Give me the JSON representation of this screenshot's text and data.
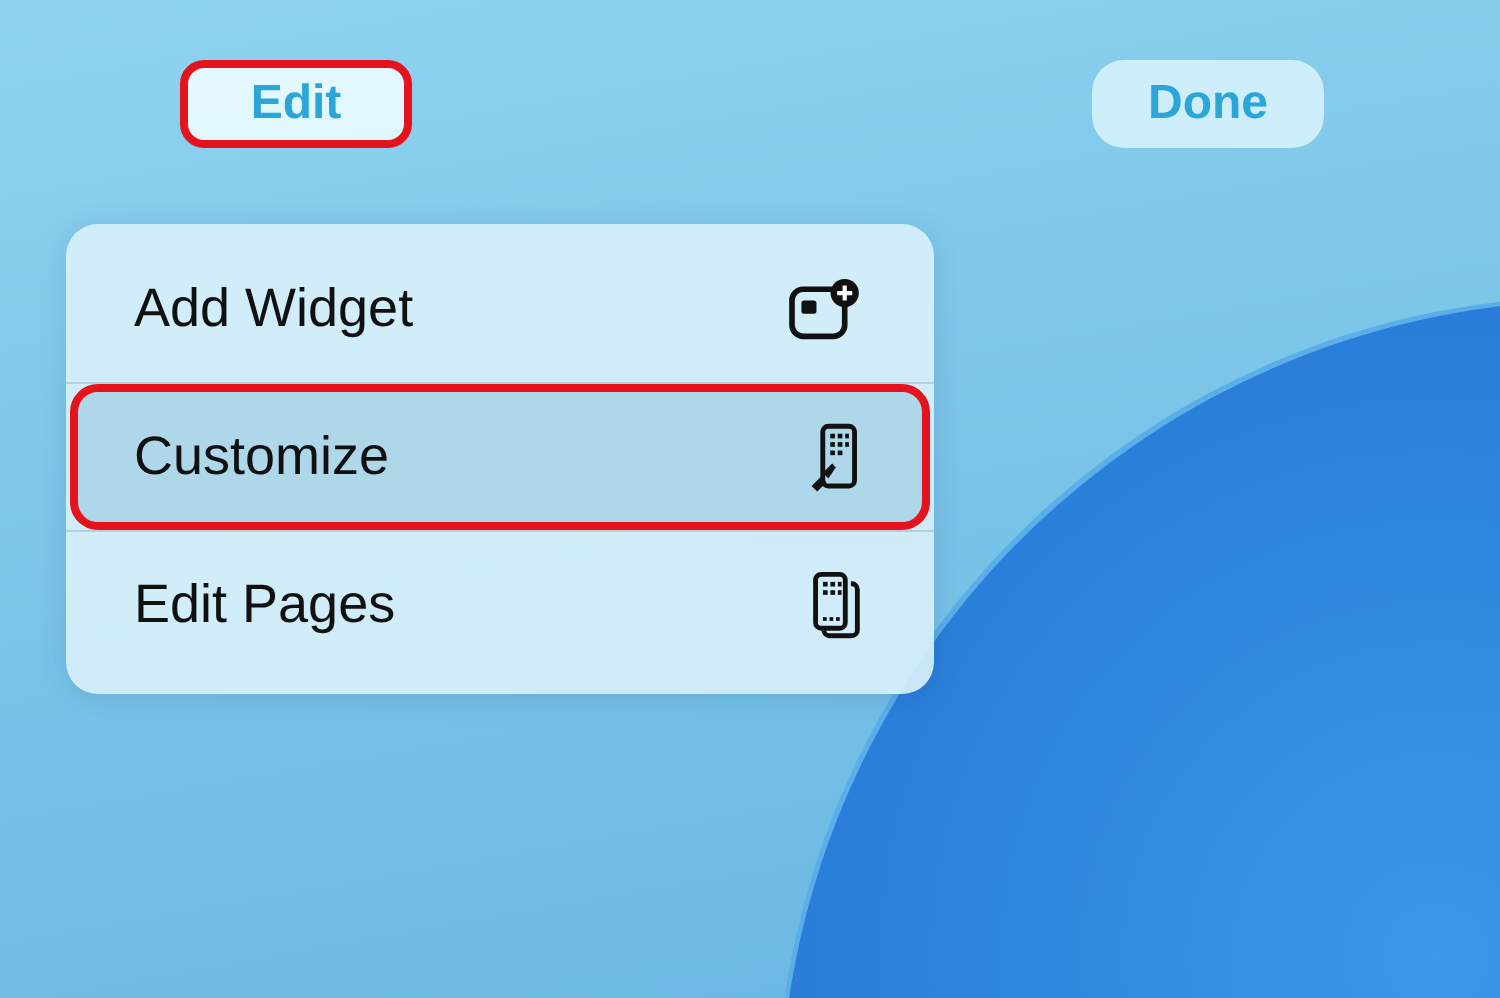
{
  "top_bar": {
    "edit_button": {
      "label": "Edit",
      "highlighted": true
    },
    "done_button": {
      "label": "Done",
      "highlighted": false
    }
  },
  "menu": {
    "items": [
      {
        "label": "Add Widget",
        "kind": "add-widget",
        "highlighted": false
      },
      {
        "label": "Customize",
        "kind": "customize",
        "highlighted": true
      },
      {
        "label": "Edit Pages",
        "kind": "pages",
        "highlighted": false
      }
    ]
  }
}
